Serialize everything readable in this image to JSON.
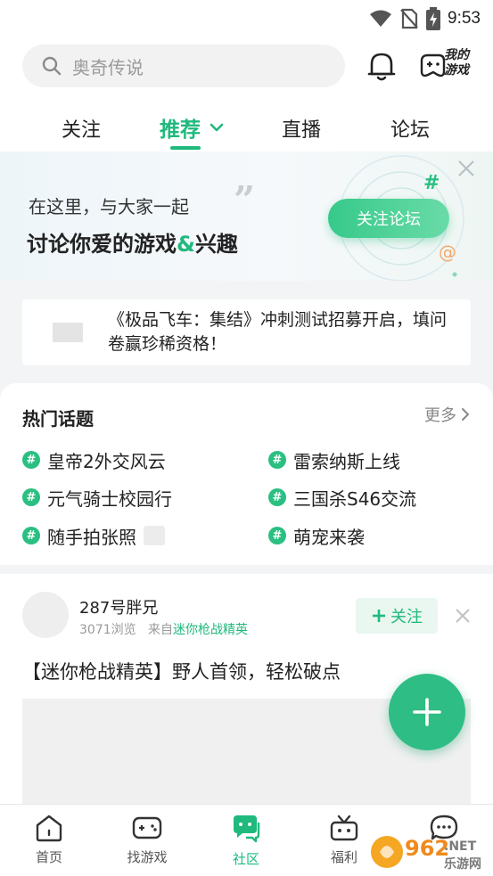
{
  "status_bar": {
    "time": "9:53"
  },
  "header": {
    "search_placeholder": "奥奇传说",
    "my_games_label_line1": "我的",
    "my_games_label_line2": "游戏"
  },
  "tabs": [
    {
      "label": "关注",
      "active": false
    },
    {
      "label": "推荐",
      "active": true
    },
    {
      "label": "直播",
      "active": false
    },
    {
      "label": "论坛",
      "active": false
    }
  ],
  "banner": {
    "line1": "在这里，与大家一起",
    "line2_part1": "讨论你爱的游戏",
    "line2_amp": "&",
    "line2_part2": "兴趣",
    "button_label": "关注论坛"
  },
  "notice": {
    "text": "《极品飞车：集结》冲刺测试招募开启，填问卷赢珍稀资格！"
  },
  "hot_topics": {
    "title": "热门话题",
    "more_label": "更多",
    "items": [
      {
        "label": "皇帝2外交风云"
      },
      {
        "label": "雷索纳斯上线"
      },
      {
        "label": "元气骑士校园行"
      },
      {
        "label": "三国杀S46交流"
      },
      {
        "label": "随手拍张照"
      },
      {
        "label": "萌宠来袭"
      }
    ]
  },
  "post": {
    "author": "287号胖兄",
    "views": "3071浏览",
    "from_prefix": "来自",
    "from_source": "迷你枪战精英",
    "follow_label": "关注",
    "title": "【迷你枪战精英】野人首领，轻松破点"
  },
  "bottom_nav": [
    {
      "label": "首页",
      "icon": "home-icon",
      "active": false
    },
    {
      "label": "找游戏",
      "icon": "gamepad-icon",
      "active": false
    },
    {
      "label": "社区",
      "icon": "community-icon",
      "active": true
    },
    {
      "label": "福利",
      "icon": "gift-icon",
      "active": false
    },
    {
      "label": "",
      "icon": "message-icon",
      "active": false
    }
  ],
  "watermark": {
    "text1": "962",
    "text2": ".NET",
    "text3": "乐游网"
  },
  "colors": {
    "accent": "#1fb97d",
    "background": "#f3f4f5"
  }
}
